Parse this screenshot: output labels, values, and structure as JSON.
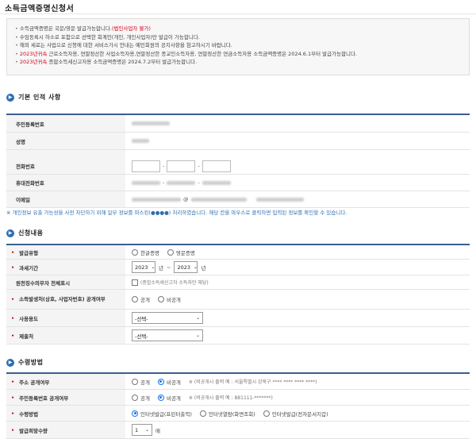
{
  "page": {
    "title": "소득금액증명신청서"
  },
  "notice": {
    "items": [
      {
        "text": "소득금액증명은 국문/영문 발급가능합니다.",
        "red": "(법인사업자 불가)"
      },
      {
        "text": "수임동록시 하소로 포함으로 선택한 회계인(개인, 개인사업자)만 발급이 가능합니다.",
        "red": ""
      },
      {
        "text": "해외 세료는 사업으로 신청에 대한 서비스가시 안내는 예민회원의 공지사항을 참고하시기 바랍니다.",
        "red": ""
      },
      {
        "text": "",
        "red": "2023년귀속",
        "rest": " 근로소득자용, 연말정산한 사업소득자용,연말정산한 종교인소득자용, 연말정산한 연금소득자용 소득금액증명은 2024.6.1부터 발급가능합니다."
      },
      {
        "text": "",
        "red": "2023년귀속",
        "rest": " 종합소득세신고자용 소득금액증명은 2024.7.2부터 발급가능합니다."
      }
    ]
  },
  "sections": {
    "basic": {
      "title": "기본 인적 사항"
    },
    "request": {
      "title": "신청내용"
    },
    "receive": {
      "title": "수령방법"
    }
  },
  "basic": {
    "rrn_label": "주민등록번호",
    "name_label": "성명",
    "phone_label": "전화번호",
    "mobile_label": "휴대전화번호",
    "email_label": "이메일"
  },
  "note": "※ 개인정보 유출 가능성을 사전 차단하기 위해 일부 정보를 마스킹(●●●●) 처리하였습니다. 해당 칸을 마우스로 클릭하면 입력된 정보를 확인할 수 있습니다.",
  "request": {
    "type_label": "발급유형",
    "type_options": [
      "한글증명",
      "영문증명"
    ],
    "period_label": "과세기간",
    "period_from": "2023",
    "period_to": "2023",
    "year_unit": "년",
    "tilde": "~",
    "newspaper_label": "원천징수의무자 전체표시",
    "newspaper_hint": "(종합소득세신고자 소득자만 해당)",
    "workplace_label": "소득발생처(상호, 사업자번호) 공개여부",
    "workplace_options": [
      "공개",
      "비공개"
    ],
    "purpose_label": "사용용도",
    "purpose_value": "-선택-",
    "submit_label": "제출처",
    "submit_value": "-선택-"
  },
  "receive": {
    "addr_label": "주소 공개여부",
    "addr_options": [
      "공개",
      "비공개"
    ],
    "addr_hint": "※ (비공개시 출력 예 : 서울특별시 강북구 **** **** **** ****)",
    "rrn_label": "주민등록번호 공개여부",
    "rrn_options": [
      "공개",
      "비공개"
    ],
    "rrn_hint": "※ (비공개시 출력 예 : 881111-*******)",
    "method_label": "수령방법",
    "method_options": [
      "인터넷발급(프린터출력)",
      "인터넷열람(화면조회)",
      "인터넷발급(전자문서지갑)"
    ],
    "count_label": "발급희망수량",
    "count_value": "1",
    "count_unit": "매"
  }
}
